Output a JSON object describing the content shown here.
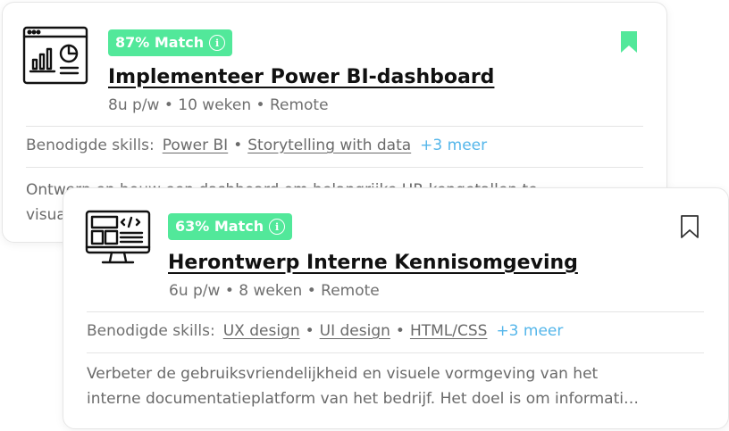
{
  "cards": [
    {
      "match": "87% Match",
      "title": "Implementeer Power BI-dashboard",
      "meta": "8u p/w • 10 weken • Remote",
      "skills_label": "Benodigde skills:",
      "skills": [
        "Power BI",
        "Storytelling with data"
      ],
      "more": "+3 meer",
      "description": [
        "Ontwerp en bouw een dashboard om belangrijke HR-kengetallen te",
        "visualiseren"
      ],
      "bookmarked": true,
      "icon": "dashboard-chart-icon"
    },
    {
      "match": "63% Match",
      "title": "Herontwerp Interne Kennisomgeving",
      "meta": "6u p/w • 8 weken • Remote",
      "skills_label": "Benodigde skills:",
      "skills": [
        "UX design",
        "UI design",
        "HTML/CSS"
      ],
      "more": "+3 meer",
      "description": [
        "Verbeter de gebruiksvriendelijkheid en visuele vormgeving van het",
        "interne documentatieplatform van het bedrijf. Het doel is om informati…"
      ],
      "bookmarked": false,
      "icon": "monitor-code-icon"
    }
  ],
  "colors": {
    "accent_green": "#52e89a",
    "link_blue": "#54b6ea",
    "text_dark": "#111111",
    "text_muted": "#6f6f6f"
  }
}
